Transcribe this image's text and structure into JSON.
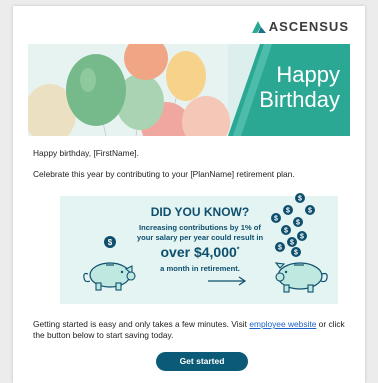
{
  "brand": {
    "name": "ASCENSUS"
  },
  "banner": {
    "line1": "Happy",
    "line2": "Birthday"
  },
  "email": {
    "greeting": "Happy birthday, [FirstName].",
    "intro": "Celebrate this year by contributing to your [PlanName] retirement plan."
  },
  "infobox": {
    "heading": "DID YOU KNOW?",
    "line1": "Increasing contributions by 1% of",
    "line2": "your salary per year could result in",
    "big": "over $4,000",
    "big_sup": "*",
    "line3": "a month in retirement."
  },
  "footer": {
    "text_before": "Getting started is easy and only takes a few minutes. Visit ",
    "link_text": "employee website",
    "text_after": " or click the button below to start saving today."
  },
  "cta": {
    "label": "Get started"
  },
  "colors": {
    "teal": "#2aa894",
    "navy": "#0b5a78",
    "mint": "#e3f4f2"
  }
}
